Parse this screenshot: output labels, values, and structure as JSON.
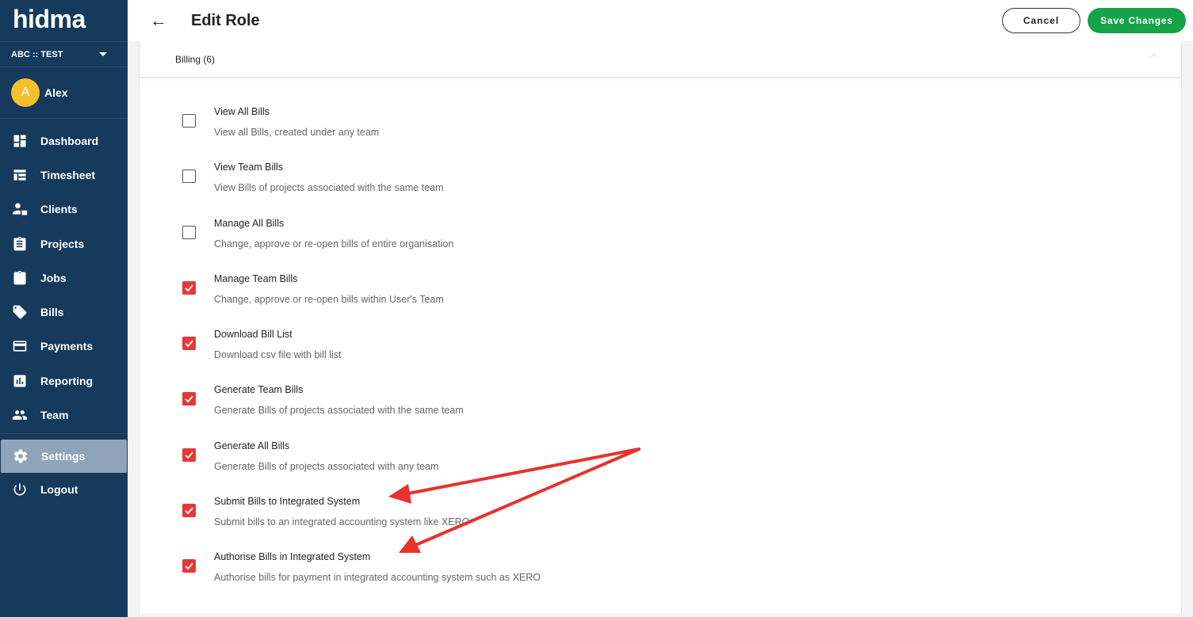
{
  "app": {
    "logo": "hidma",
    "org": "ABC :: TEST"
  },
  "user": {
    "initial": "A",
    "name": "Alex"
  },
  "nav": [
    {
      "label": "Dashboard",
      "icon": "dashboard-icon"
    },
    {
      "label": "Timesheet",
      "icon": "table-icon"
    },
    {
      "label": "Clients",
      "icon": "clients-icon"
    },
    {
      "label": "Projects",
      "icon": "clipboard-icon"
    },
    {
      "label": "Jobs",
      "icon": "clipboard-icon"
    },
    {
      "label": "Bills",
      "icon": "tag-icon"
    },
    {
      "label": "Payments",
      "icon": "credit-card-icon"
    },
    {
      "label": "Reporting",
      "icon": "bar-chart-icon"
    },
    {
      "label": "Team",
      "icon": "people-icon"
    }
  ],
  "nav_settings": "Settings",
  "nav_logout": "Logout",
  "header": {
    "title": "Edit Role",
    "cancel": "Cancel",
    "save": "Save Changes"
  },
  "section": {
    "title": "Billing (6)"
  },
  "permissions": [
    {
      "title": "View All Bills",
      "desc": "View all Bills, created under any team",
      "checked": false
    },
    {
      "title": "View Team Bills",
      "desc": "View Bills of projects associated with the same team",
      "checked": false
    },
    {
      "title": "Manage All Bills",
      "desc": "Change, approve or re-open bills of entire organisation",
      "checked": false
    },
    {
      "title": "Manage Team Bills",
      "desc": "Change, approve or re-open bills within User's Team",
      "checked": true
    },
    {
      "title": "Download Bill List",
      "desc": "Download csv file with bill list",
      "checked": true
    },
    {
      "title": "Generate Team Bills",
      "desc": "Generate Bills of projects associated with the same team",
      "checked": true
    },
    {
      "title": "Generate All Bills",
      "desc": "Generate Bills of projects associated with any team",
      "checked": true
    },
    {
      "title": "Submit Bills to Integrated System",
      "desc": "Submit bills to an integrated accounting system like XERO",
      "checked": true
    },
    {
      "title": "Authorise Bills in Integrated System",
      "desc": "Authorise bills for payment in integrated accounting system such as XERO",
      "checked": true
    }
  ],
  "colors": {
    "sidebar": "#153a5c",
    "accent_save": "#15a34a",
    "checkbox_on": "#e53935",
    "annotation_arrow": "#e8322b"
  }
}
